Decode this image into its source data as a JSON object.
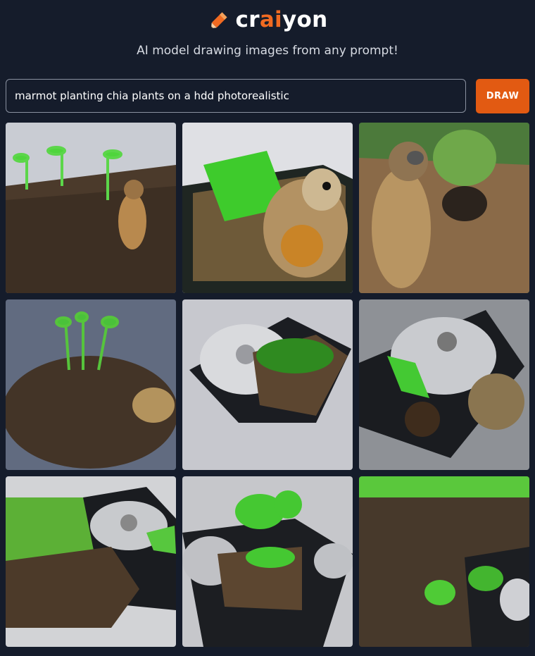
{
  "header": {
    "logo_pre": "cr",
    "logo_accent": "ai",
    "logo_post": "yon",
    "tagline": "AI model drawing images from any prompt!"
  },
  "prompt": {
    "value": "marmot planting chia plants on a hdd photorealistic"
  },
  "draw_button": {
    "label": "DRAW"
  },
  "colors": {
    "background": "#151c2b",
    "accent": "#e25a12"
  },
  "results": [
    {
      "subject": "marmot among sprouts in soil"
    },
    {
      "subject": "marmot in hdd tray with plants"
    },
    {
      "subject": "marmot standing near grass"
    },
    {
      "subject": "sprouts on soil with marmot"
    },
    {
      "subject": "hdd with soil and greens"
    },
    {
      "subject": "hdd platter with plant and marmot"
    },
    {
      "subject": "grass and soil with hdd"
    },
    {
      "subject": "hdd with plants growing"
    },
    {
      "subject": "soil field with hdd corner"
    }
  ]
}
